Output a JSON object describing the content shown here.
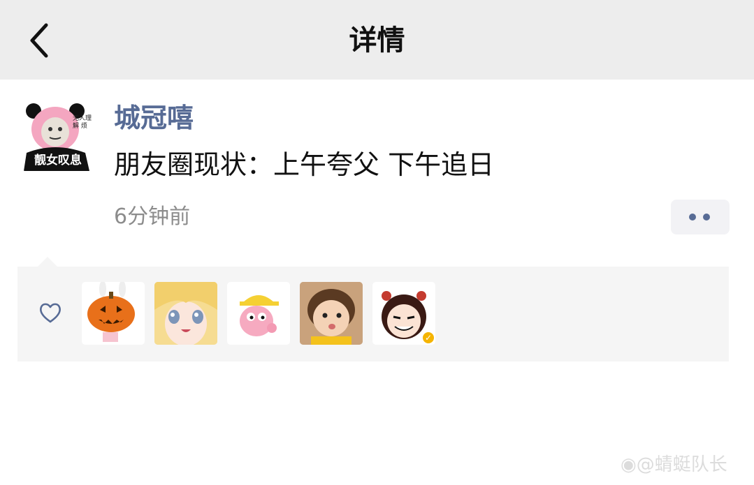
{
  "header": {
    "title": "详情",
    "back_icon": "chevron-left-icon"
  },
  "post": {
    "avatar_text": "靓女叹息",
    "avatar_side_text": "无人理解 烦",
    "username": "城冠嘻",
    "text": "朋友圈现状：上午夸父 下午追日",
    "timestamp": "6分钟前",
    "more_icon": "more-dots-icon"
  },
  "likes": {
    "heart_icon": "heart-outline-icon",
    "avatars": [
      {
        "name": "pumpkin-avatar"
      },
      {
        "name": "anime-girl-avatar"
      },
      {
        "name": "pink-cartoon-avatar"
      },
      {
        "name": "baby-photo-avatar"
      },
      {
        "name": "cartoon-girl-avatar",
        "verified_badge": true
      }
    ]
  },
  "watermark": "@蜻蜓队长",
  "colors": {
    "header_bg": "#ededed",
    "link_blue": "#576b95",
    "likes_bg": "#f5f5f5",
    "timestamp_gray": "#8c8c8c",
    "badge_gold": "#f5b400"
  }
}
